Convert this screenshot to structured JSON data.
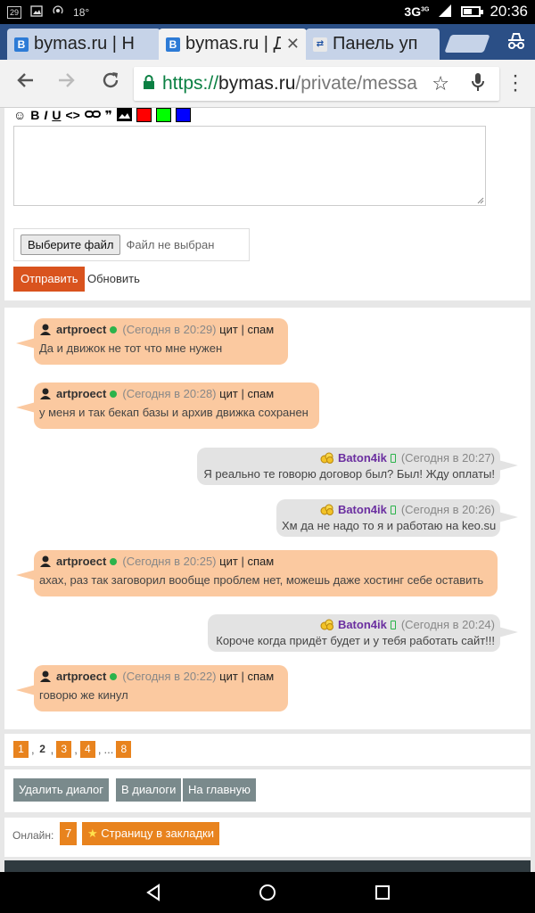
{
  "status_bar": {
    "left_icons": [
      "29",
      "image",
      "hotspot"
    ],
    "temperature": "18°",
    "network": "3G",
    "network_sup": "3G",
    "time": "20:36"
  },
  "browser": {
    "tabs": [
      {
        "title": "bymas.ru | Н",
        "favicon": "В",
        "active": false
      },
      {
        "title": "bymas.ru | Д",
        "favicon": "В",
        "active": true
      },
      {
        "title": "Панель уп",
        "favicon": "",
        "active": false
      }
    ],
    "url_scheme": "https://",
    "url_host": "bymas.ru",
    "url_path": "/private/messa",
    "icons": {
      "back": "arrow-left-icon",
      "forward": "arrow-right-icon",
      "reload": "reload-icon",
      "bookmark": "star-icon",
      "voice": "mic-icon",
      "menu": "more-vert-icon"
    }
  },
  "compose": {
    "format_tools": [
      "☺",
      "B",
      "I",
      "U",
      "<>",
      "link",
      "❞",
      "image"
    ],
    "colors": [
      "#ff0000",
      "#00ff00",
      "#0000ff"
    ],
    "choose_file_label": "Выберите файл",
    "no_file_label": "Файл не выбран",
    "send_label": "Отправить",
    "refresh_label": "Обновить"
  },
  "messages": [
    {
      "side": "in",
      "nick": "artproect",
      "time": "(Сегодня в 20:29)",
      "quote": "цит",
      "sep": "|",
      "spam": "спам",
      "text": "Да и движок не тот что мне нужен"
    },
    {
      "side": "in",
      "nick": "artproect",
      "time": "(Сегодня в 20:28)",
      "quote": "цит",
      "sep": "|",
      "spam": "спам",
      "text": "у меня и так бекап базы и архив движка сохранен"
    },
    {
      "side": "out",
      "nick": "Baton4ik",
      "time": "(Сегодня в 20:27)",
      "text": "Я реально те говорю договор был? Был! Жду оплаты!"
    },
    {
      "side": "out",
      "nick": "Baton4ik",
      "time": "(Сегодня в 20:26)",
      "text": "Хм да не надо то я и работаю на keo.su"
    },
    {
      "side": "in",
      "nick": "artproect",
      "time": "(Сегодня в 20:25)",
      "quote": "цит",
      "sep": "|",
      "spam": "спам",
      "text": "ахах, раз так заговорил вообще проблем нет, можешь даже хостинг себе оставить"
    },
    {
      "side": "out",
      "nick": "Baton4ik",
      "time": "(Сегодня в 20:24)",
      "text": "Короче когда придёт будет и у тебя работать сайт!!!"
    },
    {
      "side": "in",
      "nick": "artproect",
      "time": "(Сегодня в 20:22)",
      "quote": "цит",
      "sep": "|",
      "spam": "спам",
      "text": "говорю же кинул"
    }
  ],
  "pagination": {
    "pages": [
      "1",
      "2",
      "3",
      "4",
      "8"
    ],
    "current": "2",
    "ellipsis": "...",
    "comma": ","
  },
  "actions": {
    "delete_dialog": "Удалить диалог",
    "to_dialogs": "В диалоги",
    "to_main": "На главную"
  },
  "footer": {
    "online_label": "Онлайн:",
    "online_count": "7",
    "bookmark_label": "Страницу в закладки"
  },
  "accent_colors": {
    "orange": "#e8831e",
    "send": "#d9531e",
    "bubble_in": "#fbc9a0",
    "bubble_out": "#e3e3e3"
  }
}
